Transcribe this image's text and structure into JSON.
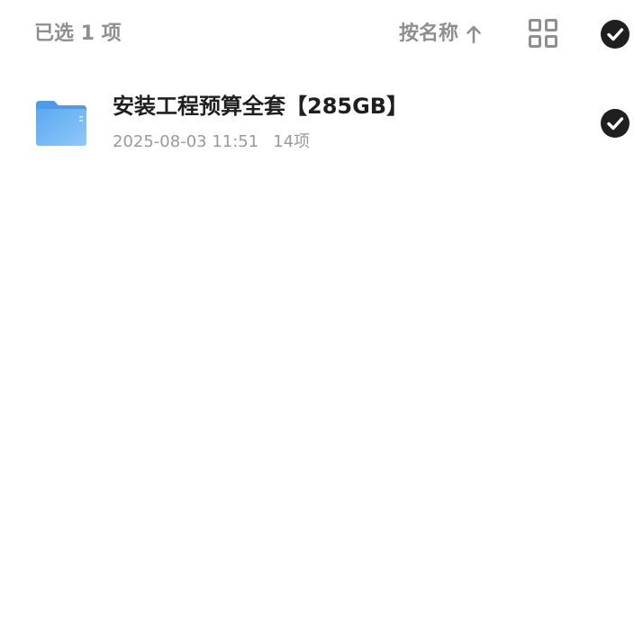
{
  "header": {
    "selected_count_label": "已选 1 项",
    "sort_label": "按名称",
    "sort_direction_icon": "arrow-up-icon",
    "grid_view_icon": "grid-icon",
    "select_all_icon": "check-circle-icon",
    "select_all_checked": true
  },
  "files": [
    {
      "name": "安装工程预算全套【285GB】",
      "modified": "2025-08-03 11:51",
      "item_count": "14项",
      "type_icon": "folder-icon",
      "selected": true
    }
  ],
  "colors": {
    "muted_text": "#8f8f8f",
    "primary_text": "#1f1f1f",
    "check_fill": "#1f1f1f",
    "folder_blue": "#6cb4f5"
  }
}
